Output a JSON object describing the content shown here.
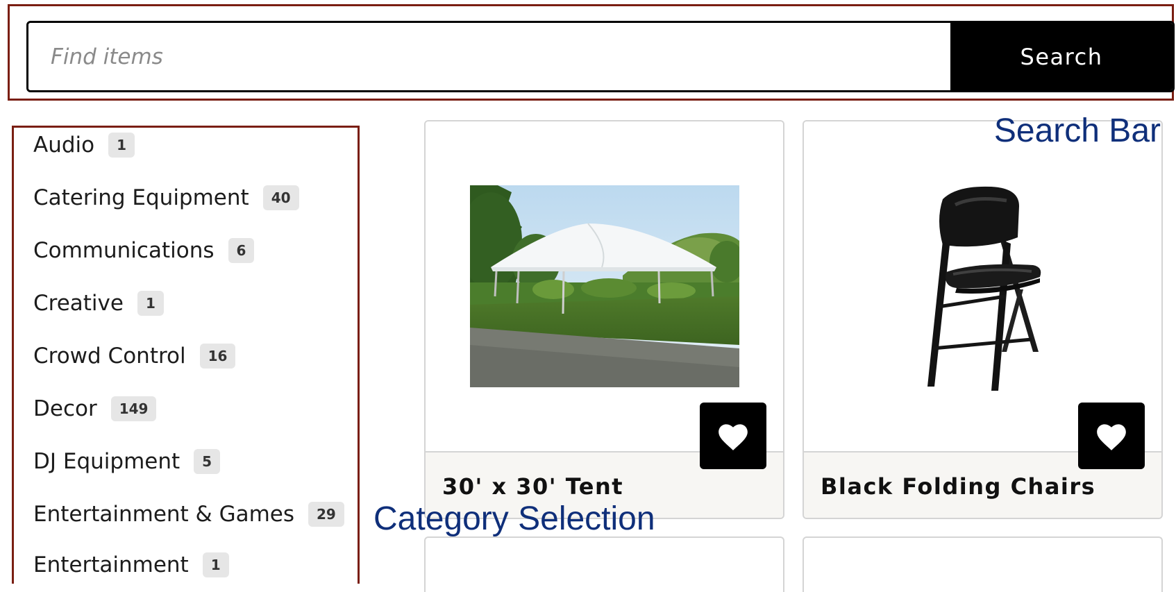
{
  "search": {
    "placeholder": "Find items",
    "button_label": "Search"
  },
  "categories": [
    {
      "name": "Audio",
      "count": "1"
    },
    {
      "name": "Catering Equipment",
      "count": "40"
    },
    {
      "name": "Communications",
      "count": "6"
    },
    {
      "name": "Creative",
      "count": "1"
    },
    {
      "name": "Crowd Control",
      "count": "16"
    },
    {
      "name": "Decor",
      "count": "149"
    },
    {
      "name": "DJ Equipment",
      "count": "5"
    },
    {
      "name": "Entertainment & Games",
      "count": "29"
    },
    {
      "name": "Entertainment",
      "count": "1"
    }
  ],
  "products": [
    {
      "title": "30' x 30' Tent",
      "image_icon": "tent-photo",
      "favorite_icon": "heart-icon"
    },
    {
      "title": "Black Folding Chairs",
      "image_icon": "folding-chair-photo",
      "favorite_icon": "heart-icon"
    }
  ],
  "annotations": {
    "search_bar": "Search Bar",
    "category_selection": "Category Selection"
  },
  "colors": {
    "region_border": "#7a1e12",
    "annotation_text": "#0f2f7a",
    "button_bg": "#000000",
    "card_footer_bg": "#f7f6f3",
    "badge_bg": "#e6e6e6"
  }
}
